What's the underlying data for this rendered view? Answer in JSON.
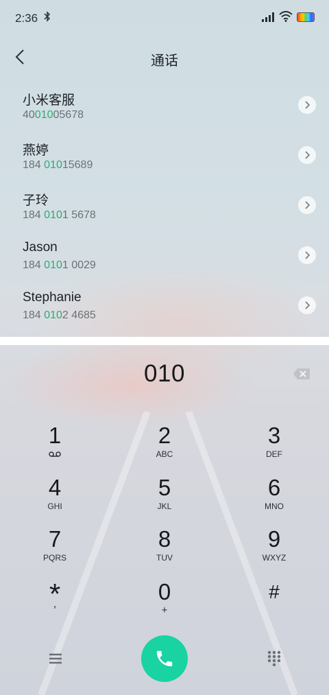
{
  "status_bar": {
    "time": "2:36"
  },
  "header": {
    "title": "通话"
  },
  "contacts": [
    {
      "name": "小米客服",
      "number_pre": "40",
      "number_hl": "010",
      "number_post": "05678"
    },
    {
      "name": "燕婷",
      "number_pre": "184 ",
      "number_hl": "010",
      "number_post": "15689"
    },
    {
      "name": "子玲",
      "number_pre": "184 ",
      "number_hl": "010",
      "number_post": "1 5678"
    },
    {
      "name": "Jason",
      "number_pre": "184 ",
      "number_hl": "010",
      "number_post": "1 0029"
    },
    {
      "name": "Stephanie",
      "number_pre": "184 ",
      "number_hl": "010",
      "number_post": "2 4685"
    }
  ],
  "dialer": {
    "input": "010"
  },
  "keypad": [
    {
      "digit": "1",
      "letters": ""
    },
    {
      "digit": "2",
      "letters": "ABC"
    },
    {
      "digit": "3",
      "letters": "DEF"
    },
    {
      "digit": "4",
      "letters": "GHI"
    },
    {
      "digit": "5",
      "letters": "JKL"
    },
    {
      "digit": "6",
      "letters": "MNO"
    },
    {
      "digit": "7",
      "letters": "PQRS"
    },
    {
      "digit": "8",
      "letters": "TUV"
    },
    {
      "digit": "9",
      "letters": "WXYZ"
    },
    {
      "digit": "*",
      "letters": ","
    },
    {
      "digit": "0",
      "letters": "+"
    },
    {
      "digit": "#",
      "letters": ""
    }
  ],
  "colors": {
    "accent_green": "#2eaa73",
    "call_button": "#19d3a2"
  },
  "icons": [
    "bluetooth-icon",
    "signal-icon",
    "wifi-icon",
    "battery-icon",
    "back-arrow-icon",
    "chevron-right-icon",
    "voicemail-icon",
    "backspace-icon",
    "menu-icon",
    "phone-icon",
    "dialpad-grid-icon"
  ]
}
